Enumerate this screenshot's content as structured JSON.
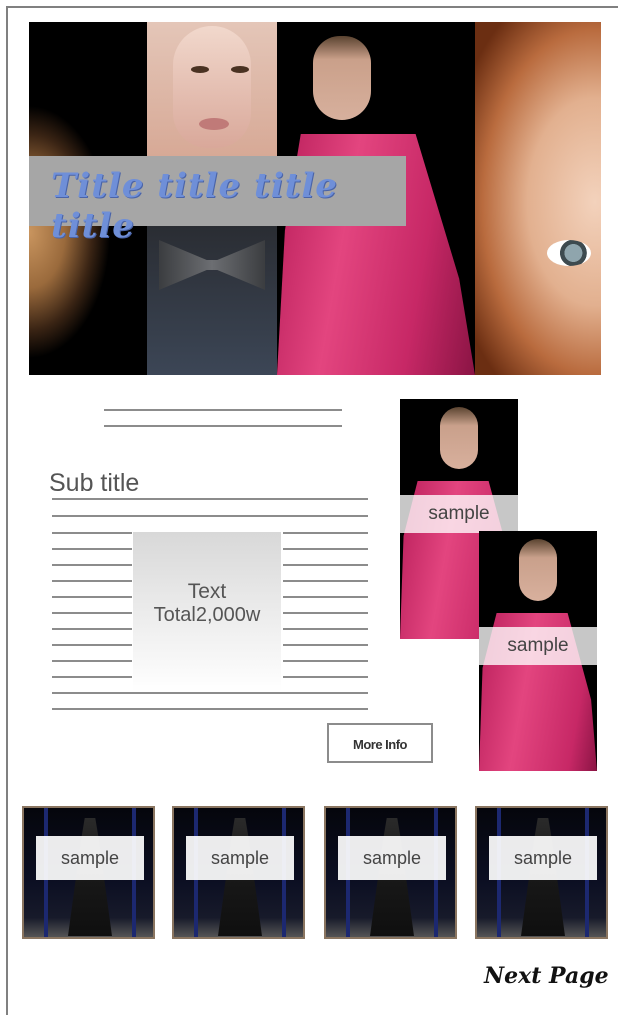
{
  "hero": {
    "title": "Title title title title"
  },
  "content": {
    "subtitle": "Sub title",
    "text_box": {
      "line1": "Text",
      "line2": "Total2,000w"
    },
    "more_info_label": "More Info"
  },
  "samples": {
    "side": [
      {
        "label": "sample"
      },
      {
        "label": "sample"
      }
    ],
    "thumbnails": [
      {
        "label": "sample"
      },
      {
        "label": "sample"
      },
      {
        "label": "sample"
      },
      {
        "label": "sample"
      }
    ]
  },
  "footer": {
    "next_page_label": "Next Page"
  }
}
